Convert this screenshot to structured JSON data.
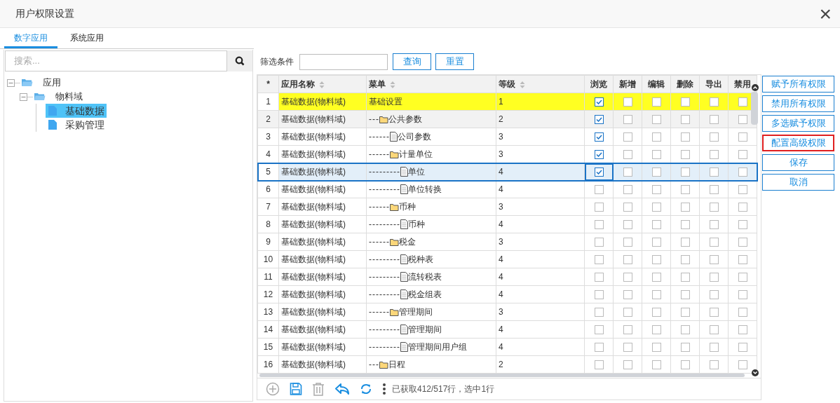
{
  "window": {
    "title": "用户权限设置",
    "close": "×"
  },
  "tabs": [
    {
      "label": "数字应用",
      "selected": true
    },
    {
      "label": "系统应用",
      "selected": false
    }
  ],
  "search": {
    "placeholder": "搜索..."
  },
  "tree": [
    {
      "label": "应用",
      "expanded": true,
      "children": [
        {
          "label": "物料域",
          "expanded": true,
          "children": [
            {
              "label": "基础数据",
              "selected": true
            },
            {
              "label": "采购管理",
              "selected": false
            }
          ]
        }
      ]
    }
  ],
  "filter": {
    "label": "筛选条件",
    "buttons": [
      "查询",
      "重置"
    ]
  },
  "table": {
    "columns": [
      "*",
      "应用名称",
      "菜单",
      "等级",
      "浏览",
      "新增",
      "编辑",
      "删除",
      "导出",
      "禁用"
    ],
    "rows": [
      {
        "no": "1",
        "app": "基础数据(物料域)",
        "prefix": "",
        "menu": "基础设置",
        "level": "1",
        "highlighted": true,
        "hovered": false,
        "selected": false,
        "perms": [
          true,
          false,
          false,
          false,
          false,
          false
        ]
      },
      {
        "no": "2",
        "app": "基础数据(物料域)",
        "prefix": "---",
        "kind": "folder",
        "menu": "公共参数",
        "level": "2",
        "highlighted": false,
        "hovered": true,
        "selected": false,
        "perms": [
          true,
          false,
          false,
          false,
          false,
          false
        ]
      },
      {
        "no": "3",
        "app": "基础数据(物料域)",
        "prefix": "------",
        "kind": "file",
        "menu": "公司参数",
        "level": "3",
        "highlighted": false,
        "hovered": false,
        "selected": false,
        "perms": [
          true,
          false,
          false,
          false,
          false,
          false
        ]
      },
      {
        "no": "4",
        "app": "基础数据(物料域)",
        "prefix": "------",
        "kind": "folder",
        "menu": "计量单位",
        "level": "3",
        "highlighted": false,
        "hovered": false,
        "selected": false,
        "perms": [
          true,
          false,
          false,
          false,
          false,
          false
        ]
      },
      {
        "no": "5",
        "app": "基础数据(物料域)",
        "prefix": "---------",
        "kind": "file",
        "menu": "单位",
        "level": "4",
        "highlighted": false,
        "hovered": false,
        "selected": true,
        "perms": [
          true,
          false,
          false,
          false,
          false,
          false
        ]
      },
      {
        "no": "6",
        "app": "基础数据(物料域)",
        "prefix": "---------",
        "kind": "file",
        "menu": "单位转换",
        "level": "4",
        "highlighted": false,
        "hovered": false,
        "selected": false,
        "perms": [
          false,
          false,
          false,
          false,
          false,
          false
        ]
      },
      {
        "no": "7",
        "app": "基础数据(物料域)",
        "prefix": "------",
        "kind": "folder",
        "menu": "币种",
        "level": "3",
        "highlighted": false,
        "hovered": false,
        "selected": false,
        "perms": [
          false,
          false,
          false,
          false,
          false,
          false
        ]
      },
      {
        "no": "8",
        "app": "基础数据(物料域)",
        "prefix": "---------",
        "kind": "file",
        "menu": "币种",
        "level": "4",
        "highlighted": false,
        "hovered": false,
        "selected": false,
        "perms": [
          false,
          false,
          false,
          false,
          false,
          false
        ]
      },
      {
        "no": "9",
        "app": "基础数据(物料域)",
        "prefix": "------",
        "kind": "folder",
        "menu": "税金",
        "level": "3",
        "highlighted": false,
        "hovered": false,
        "selected": false,
        "perms": [
          false,
          false,
          false,
          false,
          false,
          false
        ]
      },
      {
        "no": "10",
        "app": "基础数据(物料域)",
        "prefix": "---------",
        "kind": "file",
        "menu": "税种表",
        "level": "4",
        "highlighted": false,
        "hovered": false,
        "selected": false,
        "perms": [
          false,
          false,
          false,
          false,
          false,
          false
        ]
      },
      {
        "no": "11",
        "app": "基础数据(物料域)",
        "prefix": "---------",
        "kind": "file",
        "menu": "流转税表",
        "level": "4",
        "highlighted": false,
        "hovered": false,
        "selected": false,
        "perms": [
          false,
          false,
          false,
          false,
          false,
          false
        ]
      },
      {
        "no": "12",
        "app": "基础数据(物料域)",
        "prefix": "---------",
        "kind": "file",
        "menu": "税金组表",
        "level": "4",
        "highlighted": false,
        "hovered": false,
        "selected": false,
        "perms": [
          false,
          false,
          false,
          false,
          false,
          false
        ]
      },
      {
        "no": "13",
        "app": "基础数据(物料域)",
        "prefix": "------",
        "kind": "folder",
        "menu": "管理期间",
        "level": "3",
        "highlighted": false,
        "hovered": false,
        "selected": false,
        "perms": [
          false,
          false,
          false,
          false,
          false,
          false
        ]
      },
      {
        "no": "14",
        "app": "基础数据(物料域)",
        "prefix": "---------",
        "kind": "file",
        "menu": "管理期间",
        "level": "4",
        "highlighted": false,
        "hovered": false,
        "selected": false,
        "perms": [
          false,
          false,
          false,
          false,
          false,
          false
        ]
      },
      {
        "no": "15",
        "app": "基础数据(物料域)",
        "prefix": "---------",
        "kind": "file",
        "menu": "管理期间用户组",
        "level": "4",
        "highlighted": false,
        "hovered": false,
        "selected": false,
        "perms": [
          false,
          false,
          false,
          false,
          false,
          false
        ]
      },
      {
        "no": "16",
        "app": "基础数据(物料域)",
        "prefix": "---",
        "kind": "folder",
        "menu": "日程",
        "level": "2",
        "highlighted": false,
        "hovered": false,
        "selected": false,
        "perms": [
          false,
          false,
          false,
          false,
          false,
          false
        ]
      }
    ]
  },
  "status": "已获取412/517行，选中1行",
  "actions": [
    {
      "label": "赋予所有权限",
      "focused": false
    },
    {
      "label": "禁用所有权限",
      "focused": false
    },
    {
      "label": "多选赋予权限",
      "focused": false
    },
    {
      "label": "配置高级权限",
      "focused": true
    },
    {
      "label": "保存",
      "focused": false
    },
    {
      "label": "取消",
      "focused": false
    }
  ]
}
